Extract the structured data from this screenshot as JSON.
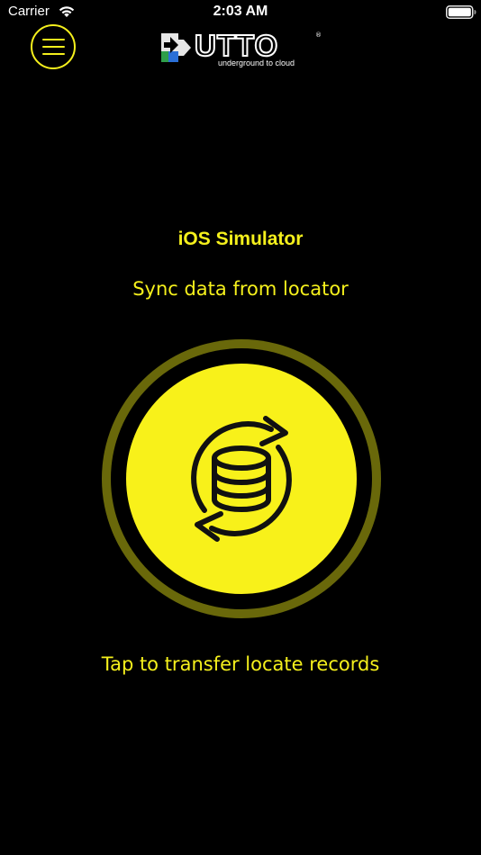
{
  "status_bar": {
    "carrier": "Carrier",
    "time": "2:03 AM",
    "wifi_icon": "wifi-icon",
    "battery_icon": "battery-full-icon"
  },
  "header": {
    "menu_icon": "hamburger-menu-icon",
    "logo": {
      "brand_text": "UTTO",
      "registered_mark": "®",
      "tagline": "underground to cloud"
    }
  },
  "main": {
    "device_name": "iOS Simulator",
    "heading": "Sync data from locator",
    "sync_button_icon": "database-sync-icon",
    "hint": "Tap to transfer locate records"
  },
  "colors": {
    "background": "#000000",
    "accent_yellow": "#f8f11a",
    "ring_olive": "#69680a",
    "text_white": "#ffffff",
    "logo_green": "#2e9e4a",
    "logo_blue": "#2a6fd6"
  }
}
